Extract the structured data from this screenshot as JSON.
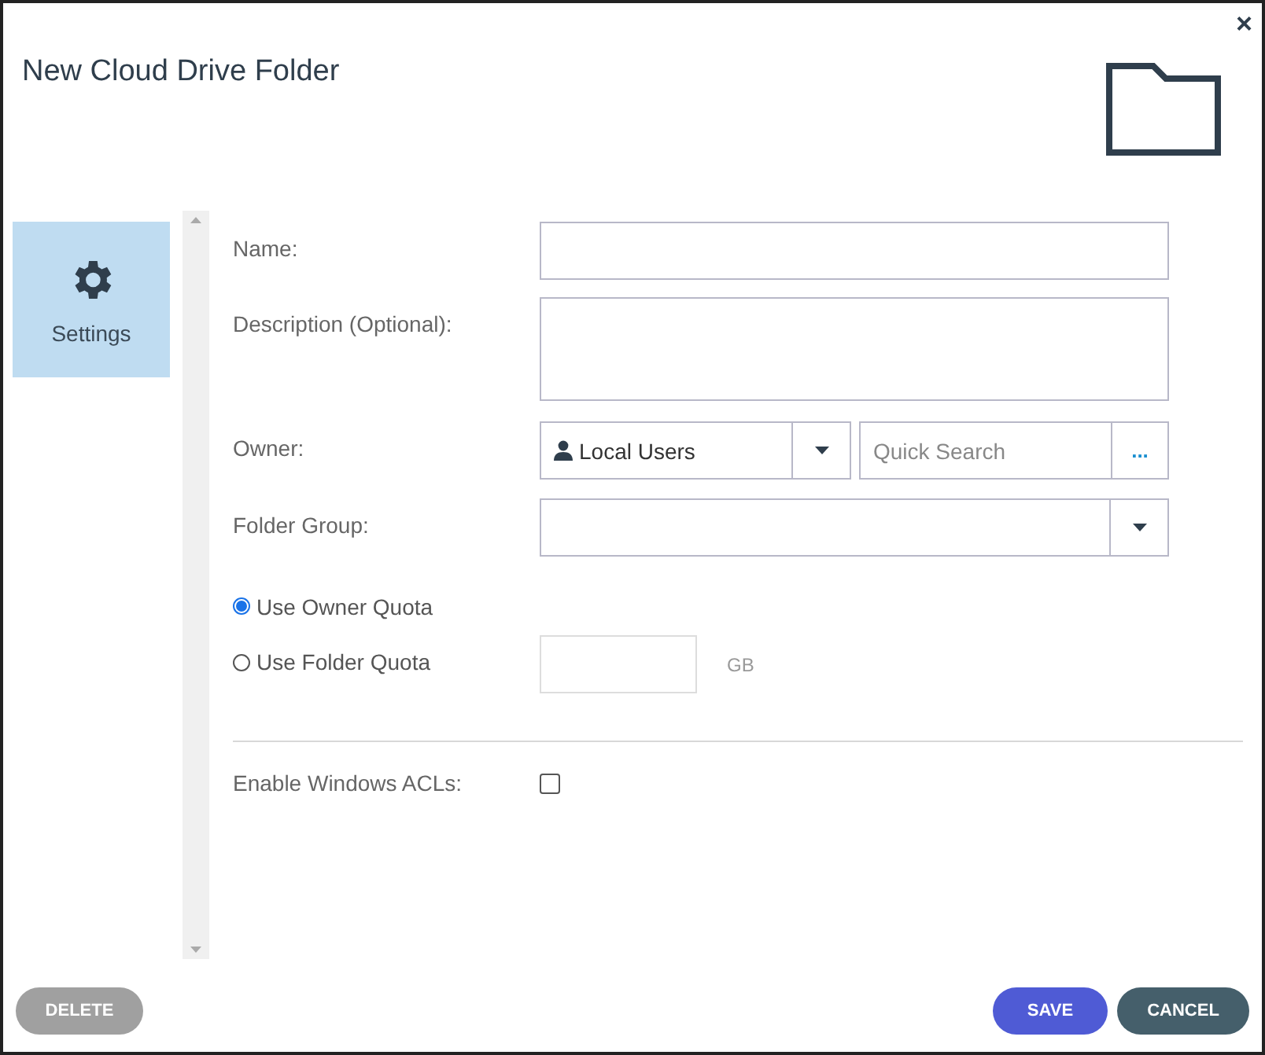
{
  "dialog": {
    "title": "New Cloud Drive Folder",
    "close": "×"
  },
  "sidebar": {
    "items": [
      {
        "label": "Settings",
        "selected": true
      }
    ]
  },
  "form": {
    "name": {
      "label": "Name:"
    },
    "description": {
      "label": "Description (Optional):"
    },
    "owner": {
      "label": "Owner:",
      "source": "Local Users",
      "search_placeholder": "Quick Search",
      "browse": "..."
    },
    "folder_group": {
      "label": "Folder Group:"
    },
    "quota_options": [
      {
        "label": "Use Owner Quota",
        "selected": true
      },
      {
        "label": "Use Folder Quota",
        "selected": false
      }
    ],
    "folder_quota": {
      "unit": "GB",
      "disabled": true
    },
    "windows_acls": {
      "label": "Enable Windows ACLs:",
      "checked": false
    }
  },
  "buttons": [
    {
      "label": "DELETE",
      "kind": "delete"
    },
    {
      "label": "SAVE",
      "kind": "save"
    },
    {
      "label": "CANCEL",
      "kind": "cancel"
    }
  ]
}
